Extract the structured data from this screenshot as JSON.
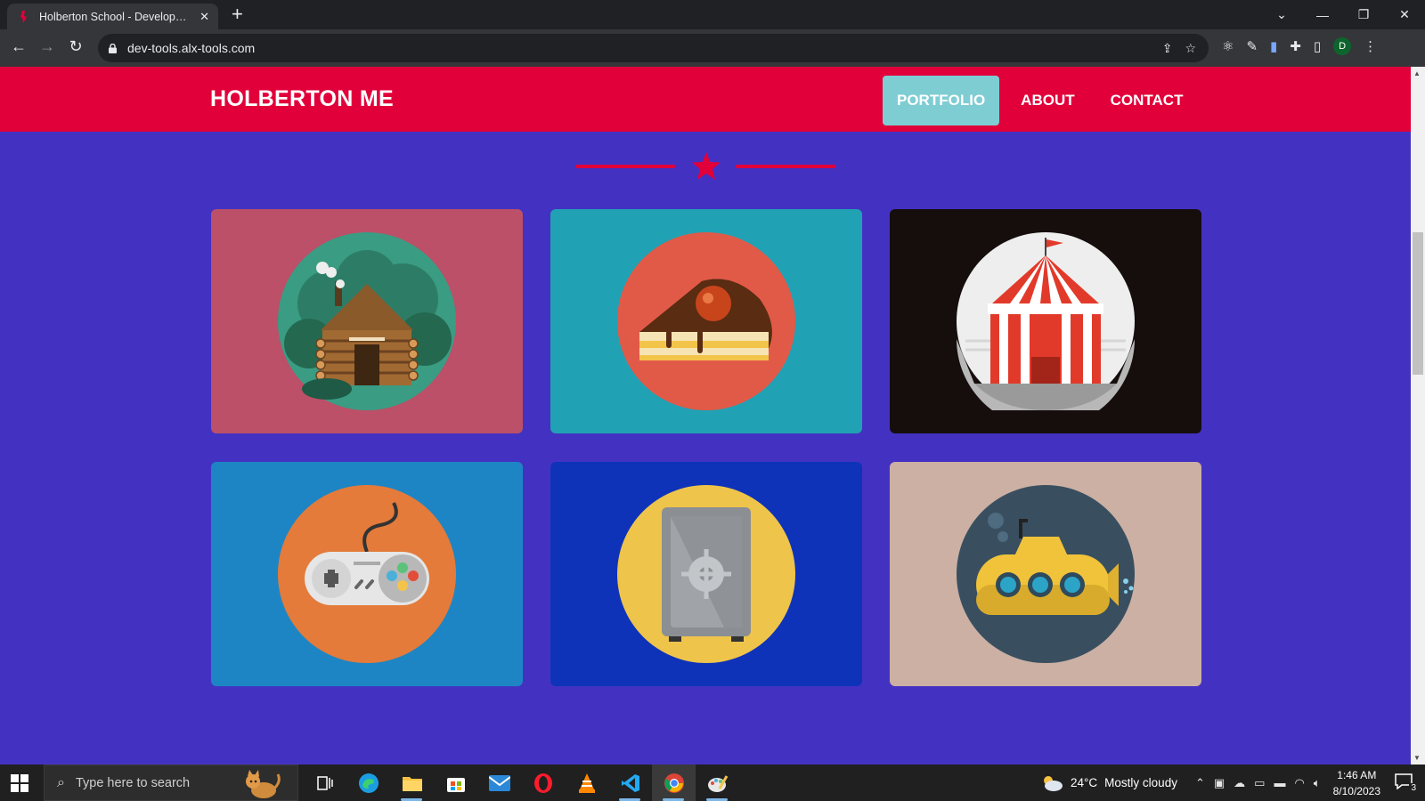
{
  "browser": {
    "tab_title": "Holberton School - Developer to",
    "url": "dev-tools.alx-tools.com",
    "profile_initial": "D"
  },
  "site": {
    "brand": "HOLBERTON ME",
    "nav": [
      {
        "label": "PORTFOLIO",
        "active": true
      },
      {
        "label": "ABOUT",
        "active": false
      },
      {
        "label": "CONTACT",
        "active": false
      }
    ],
    "divider_icon": "star-icon",
    "portfolio": [
      {
        "name": "cabin",
        "icon": "log-cabin-icon",
        "bg": "#bb5068",
        "circle": "#3a9c82"
      },
      {
        "name": "cake",
        "icon": "cake-slice-icon",
        "bg": "#21a1b4",
        "circle": "#e15a48"
      },
      {
        "name": "circus",
        "icon": "circus-tent-icon",
        "bg": "#150e0d",
        "circle": "#eeeeee"
      },
      {
        "name": "game",
        "icon": "game-controller-icon",
        "bg": "#1e85c4",
        "circle": "#e47b3a"
      },
      {
        "name": "safe",
        "icon": "safe-icon",
        "bg": "#0e33b9",
        "circle": "#eec44a"
      },
      {
        "name": "submarine",
        "icon": "submarine-icon",
        "bg": "#cbb0a3",
        "circle": "#394f60"
      }
    ]
  },
  "colors": {
    "page_bg": "#4332c2",
    "header_bg": "#e1003a",
    "nav_active_bg": "#7ecdd3"
  },
  "taskbar": {
    "search_placeholder": "Type here to search",
    "weather_temp": "24°C",
    "weather_text": "Mostly cloudy",
    "time": "1:46 AM",
    "date": "8/10/2023",
    "notifications": "3"
  }
}
